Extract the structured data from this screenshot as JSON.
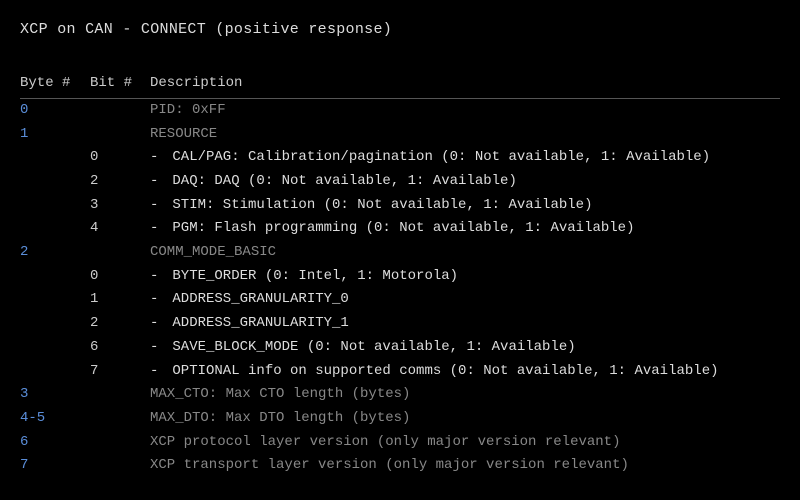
{
  "title": "XCP on CAN - CONNECT (positive response)",
  "headers": {
    "byte": "Byte #",
    "bit": "Bit #",
    "desc": "Description"
  },
  "rows": [
    {
      "byte": "0",
      "bit": "",
      "main": true,
      "desc": "PID: 0xFF"
    },
    {
      "byte": "1",
      "bit": "",
      "main": true,
      "desc": "RESOURCE"
    },
    {
      "byte": "",
      "bit": "0",
      "main": false,
      "desc": "CAL/PAG: Calibration/pagination (0: Not available, 1: Available)"
    },
    {
      "byte": "",
      "bit": "2",
      "main": false,
      "desc": "DAQ: DAQ (0: Not available, 1: Available)"
    },
    {
      "byte": "",
      "bit": "3",
      "main": false,
      "desc": "STIM: Stimulation (0: Not available, 1: Available)"
    },
    {
      "byte": "",
      "bit": "4",
      "main": false,
      "desc": "PGM: Flash programming (0: Not available, 1: Available)"
    },
    {
      "byte": "2",
      "bit": "",
      "main": true,
      "desc": "COMM_MODE_BASIC"
    },
    {
      "byte": "",
      "bit": "0",
      "main": false,
      "desc": "BYTE_ORDER (0: Intel, 1: Motorola)"
    },
    {
      "byte": "",
      "bit": "1",
      "main": false,
      "desc": "ADDRESS_GRANULARITY_0"
    },
    {
      "byte": "",
      "bit": "2",
      "main": false,
      "desc": "ADDRESS_GRANULARITY_1"
    },
    {
      "byte": "",
      "bit": "6",
      "main": false,
      "desc": "SAVE_BLOCK_MODE (0: Not available, 1: Available)"
    },
    {
      "byte": "",
      "bit": "7",
      "main": false,
      "desc": "OPTIONAL info on supported comms (0: Not available, 1: Available)"
    },
    {
      "byte": "3",
      "bit": "",
      "main": true,
      "desc": "MAX_CTO: Max CTO length (bytes)"
    },
    {
      "byte": "4-5",
      "bit": "",
      "main": true,
      "desc": "MAX_DTO: Max DTO length (bytes)"
    },
    {
      "byte": "6",
      "bit": "",
      "main": true,
      "desc": "XCP protocol layer version (only major version relevant)"
    },
    {
      "byte": "7",
      "bit": "",
      "main": true,
      "desc": "XCP transport layer version (only major version relevant)"
    }
  ]
}
